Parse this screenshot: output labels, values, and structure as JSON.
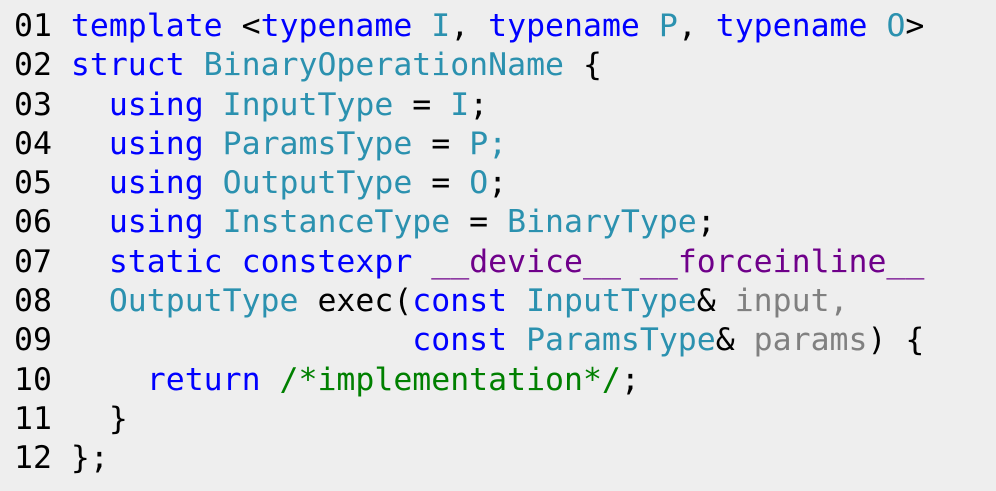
{
  "code": {
    "lines": [
      {
        "number": "01",
        "tokens": [
          {
            "type": "kw",
            "text": "template"
          },
          {
            "type": "pl",
            "text": " <"
          },
          {
            "type": "kw",
            "text": "typename"
          },
          {
            "type": "pl",
            "text": " "
          },
          {
            "type": "ty",
            "text": "I"
          },
          {
            "type": "pl",
            "text": ", "
          },
          {
            "type": "kw",
            "text": "typename"
          },
          {
            "type": "pl",
            "text": " "
          },
          {
            "type": "ty",
            "text": "P"
          },
          {
            "type": "pl",
            "text": ", "
          },
          {
            "type": "kw",
            "text": "typename"
          },
          {
            "type": "pl",
            "text": " "
          },
          {
            "type": "ty",
            "text": "O"
          },
          {
            "type": "pl",
            "text": ">"
          }
        ]
      },
      {
        "number": "02",
        "tokens": [
          {
            "type": "kw",
            "text": "struct"
          },
          {
            "type": "pl",
            "text": " "
          },
          {
            "type": "ty",
            "text": "BinaryOperationName"
          },
          {
            "type": "pl",
            "text": " {"
          }
        ]
      },
      {
        "number": "03",
        "tokens": [
          {
            "type": "pl",
            "text": "  "
          },
          {
            "type": "kw",
            "text": "using"
          },
          {
            "type": "pl",
            "text": " "
          },
          {
            "type": "ty",
            "text": "InputType"
          },
          {
            "type": "pl",
            "text": " = "
          },
          {
            "type": "ty",
            "text": "I"
          },
          {
            "type": "pl",
            "text": ";"
          }
        ]
      },
      {
        "number": "04",
        "tokens": [
          {
            "type": "pl",
            "text": "  "
          },
          {
            "type": "kw",
            "text": "using"
          },
          {
            "type": "pl",
            "text": " "
          },
          {
            "type": "ty",
            "text": "ParamsType"
          },
          {
            "type": "pl",
            "text": " = "
          },
          {
            "type": "ty",
            "text": "P;"
          }
        ]
      },
      {
        "number": "05",
        "tokens": [
          {
            "type": "pl",
            "text": "  "
          },
          {
            "type": "kw",
            "text": "using"
          },
          {
            "type": "pl",
            "text": " "
          },
          {
            "type": "ty",
            "text": "OutputType"
          },
          {
            "type": "pl",
            "text": " = "
          },
          {
            "type": "ty",
            "text": "O"
          },
          {
            "type": "pl",
            "text": ";"
          }
        ]
      },
      {
        "number": "06",
        "tokens": [
          {
            "type": "pl",
            "text": "  "
          },
          {
            "type": "kw",
            "text": "using"
          },
          {
            "type": "pl",
            "text": " "
          },
          {
            "type": "ty",
            "text": "InstanceType"
          },
          {
            "type": "pl",
            "text": " = "
          },
          {
            "type": "ty",
            "text": "BinaryType"
          },
          {
            "type": "pl",
            "text": ";"
          }
        ]
      },
      {
        "number": "07",
        "tokens": [
          {
            "type": "pl",
            "text": "  "
          },
          {
            "type": "kw",
            "text": "static"
          },
          {
            "type": "pl",
            "text": " "
          },
          {
            "type": "kw",
            "text": "constexpr"
          },
          {
            "type": "pl",
            "text": " "
          },
          {
            "type": "mc",
            "text": "__device__"
          },
          {
            "type": "pl",
            "text": " "
          },
          {
            "type": "mc",
            "text": "__forceinline__"
          }
        ]
      },
      {
        "number": "08",
        "tokens": [
          {
            "type": "pl",
            "text": "  "
          },
          {
            "type": "ty",
            "text": "OutputType"
          },
          {
            "type": "pl",
            "text": " exec("
          },
          {
            "type": "kw",
            "text": "const"
          },
          {
            "type": "pl",
            "text": " "
          },
          {
            "type": "ty",
            "text": "InputType"
          },
          {
            "type": "pl",
            "text": "& "
          },
          {
            "type": "pr",
            "text": "input,"
          }
        ]
      },
      {
        "number": "09",
        "tokens": [
          {
            "type": "pl",
            "text": "                  "
          },
          {
            "type": "kw",
            "text": "const"
          },
          {
            "type": "pl",
            "text": " "
          },
          {
            "type": "ty",
            "text": "ParamsType"
          },
          {
            "type": "pl",
            "text": "& "
          },
          {
            "type": "pr",
            "text": "params"
          },
          {
            "type": "pl",
            "text": ") {"
          }
        ]
      },
      {
        "number": "10",
        "tokens": [
          {
            "type": "pl",
            "text": "    "
          },
          {
            "type": "kw",
            "text": "return"
          },
          {
            "type": "pl",
            "text": " "
          },
          {
            "type": "cm",
            "text": "/*implementation*/"
          },
          {
            "type": "pl",
            "text": ";"
          }
        ]
      },
      {
        "number": "11",
        "tokens": [
          {
            "type": "pl",
            "text": "  }"
          }
        ]
      },
      {
        "number": "12",
        "tokens": [
          {
            "type": "pl",
            "text": "};"
          }
        ]
      }
    ]
  },
  "colors": {
    "background": "#eeeeee",
    "keyword": "#0000ff",
    "type": "#2b91af",
    "macro": "#6f008a",
    "parameter": "#808080",
    "comment": "#008000",
    "plain": "#000000"
  }
}
